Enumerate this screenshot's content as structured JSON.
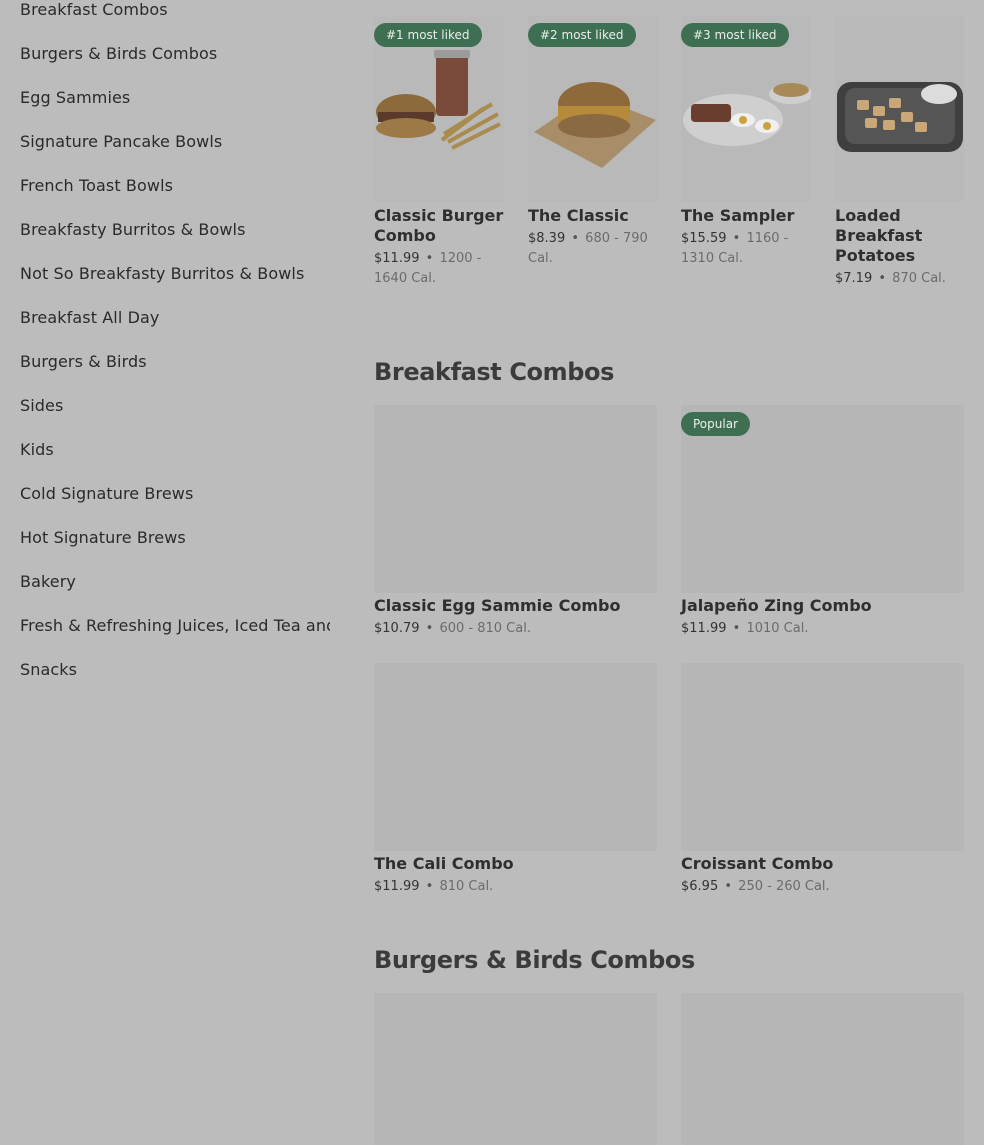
{
  "sidebar": {
    "categories": [
      "Breakfast Combos",
      "Burgers & Birds Combos",
      "Egg Sammies",
      "Signature Pancake Bowls",
      "French Toast Bowls",
      "Breakfasty Burritos & Bowls",
      "Not So Breakfasty Burritos & Bowls",
      "Breakfast All Day",
      "Burgers & Birds",
      "Sides",
      "Kids",
      "Cold Signature Brews",
      "Hot Signature Brews",
      "Bakery",
      "Fresh & Refreshing Juices, Iced Tea and Lemonade",
      "Snacks"
    ]
  },
  "most_liked": [
    {
      "badge": "#1 most liked",
      "name": "Classic Burger Combo",
      "price": "$11.99",
      "cal": "1200 - 1640 Cal."
    },
    {
      "badge": "#2 most liked",
      "name": "The Classic",
      "price": "$8.39",
      "cal": "680 - 790 Cal."
    },
    {
      "badge": "#3 most liked",
      "name": "The Sampler",
      "price": "$15.59",
      "cal": "1160 - 1310 Cal."
    },
    {
      "badge": "",
      "name": "Loaded Breakfast Potatoes",
      "price": "$7.19",
      "cal": "870 Cal."
    }
  ],
  "sections": [
    {
      "title": "Breakfast Combos",
      "items": [
        {
          "badge": "",
          "name": "Classic Egg Sammie Combo",
          "price": "$10.79",
          "cal": "600 - 810 Cal."
        },
        {
          "badge": "Popular",
          "name": "Jalapeño Zing Combo",
          "price": "$11.99",
          "cal": "1010 Cal."
        },
        {
          "badge": "",
          "name": "The Cali Combo",
          "price": "$11.99",
          "cal": "810 Cal."
        },
        {
          "badge": "",
          "name": "Croissant Combo",
          "price": "$6.95",
          "cal": "250 - 260 Cal."
        }
      ]
    },
    {
      "title": "Burgers & Birds Combos",
      "items": []
    }
  ],
  "separator": "•",
  "colors": {
    "overlay_bg": "#bcbcbc",
    "badge_bg": "#3f6f52",
    "badge_text": "#e9efe9"
  }
}
